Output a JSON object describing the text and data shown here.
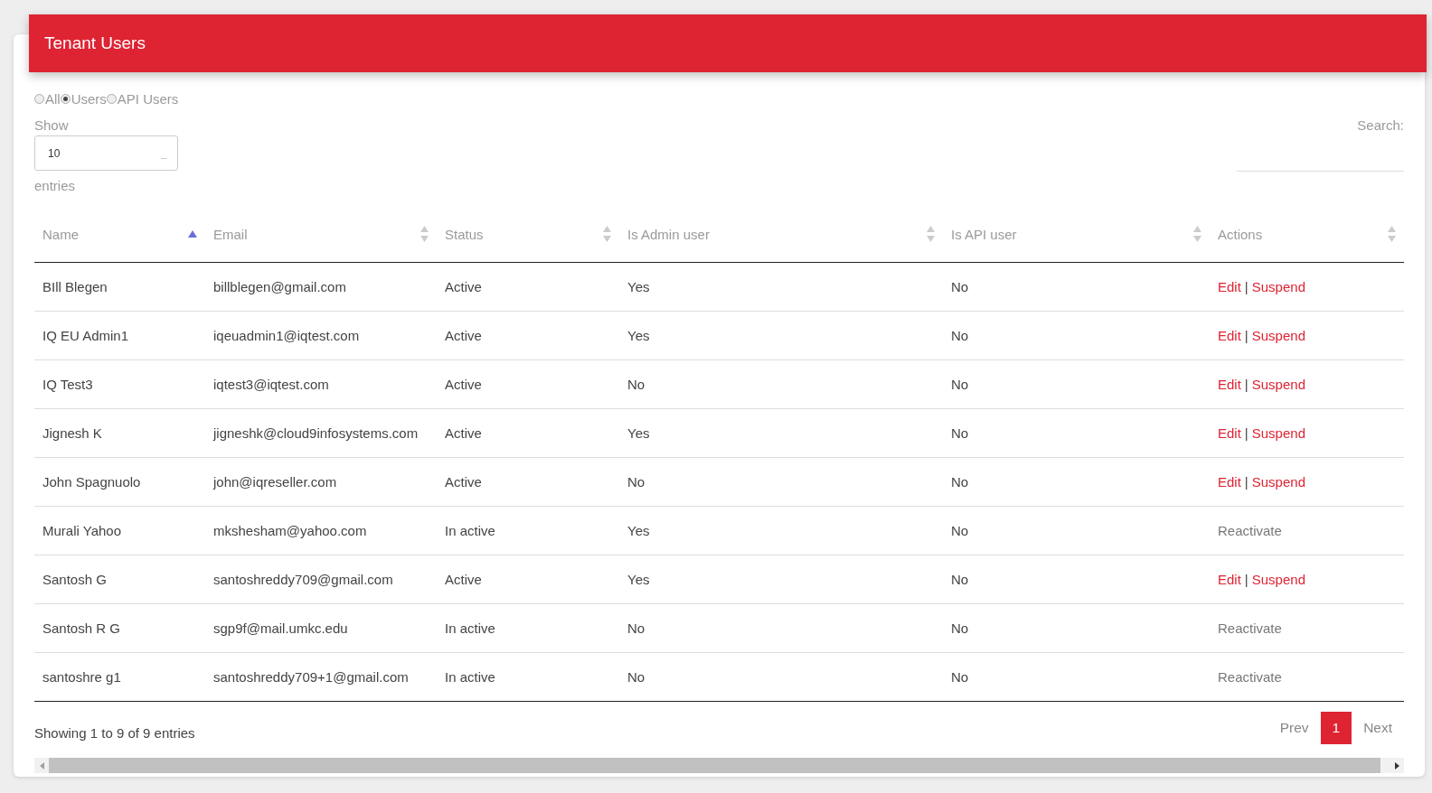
{
  "header": {
    "title": "Tenant Users"
  },
  "filters": [
    {
      "label": "All",
      "selected": false
    },
    {
      "label": "Users",
      "selected": true
    },
    {
      "label": "API Users",
      "selected": false
    }
  ],
  "length_control": {
    "label": "Show",
    "value": "10",
    "caret": "_",
    "suffix": "entries"
  },
  "search": {
    "label": "Search:"
  },
  "table": {
    "columns": [
      {
        "label": "Name",
        "sorted": true
      },
      {
        "label": "Email",
        "sorted": false
      },
      {
        "label": "Status",
        "sorted": false
      },
      {
        "label": "Is Admin user",
        "sorted": false
      },
      {
        "label": "Is API user",
        "sorted": false
      },
      {
        "label": "Actions",
        "sorted": false
      }
    ],
    "rows": [
      {
        "cells": [
          "BIll Blegen",
          "billblegen@gmail.com",
          "Active",
          "Yes",
          "No"
        ],
        "actions": [
          {
            "kind": "link",
            "label": "Edit"
          },
          {
            "kind": "separator",
            "label": "|"
          },
          {
            "kind": "link",
            "label": "Suspend"
          }
        ]
      },
      {
        "cells": [
          "IQ EU Admin1",
          "iqeuadmin1@iqtest.com",
          "Active",
          "Yes",
          "No"
        ],
        "actions": [
          {
            "kind": "link",
            "label": "Edit"
          },
          {
            "kind": "separator",
            "label": "|"
          },
          {
            "kind": "link",
            "label": "Suspend"
          }
        ]
      },
      {
        "cells": [
          "IQ Test3",
          "iqtest3@iqtest.com",
          "Active",
          "No",
          "No"
        ],
        "actions": [
          {
            "kind": "link",
            "label": "Edit"
          },
          {
            "kind": "separator",
            "label": "|"
          },
          {
            "kind": "link",
            "label": "Suspend"
          }
        ]
      },
      {
        "cells": [
          "Jignesh K",
          "jigneshk@cloud9infosystems.com",
          "Active",
          "Yes",
          "No"
        ],
        "actions": [
          {
            "kind": "link",
            "label": "Edit"
          },
          {
            "kind": "separator",
            "label": "|"
          },
          {
            "kind": "link",
            "label": "Suspend"
          }
        ]
      },
      {
        "cells": [
          "John Spagnuolo",
          "john@iqreseller.com",
          "Active",
          "No",
          "No"
        ],
        "actions": [
          {
            "kind": "link",
            "label": "Edit"
          },
          {
            "kind": "separator",
            "label": "|"
          },
          {
            "kind": "link",
            "label": "Suspend"
          }
        ]
      },
      {
        "cells": [
          "Murali Yahoo",
          "mkshesham@yahoo.com",
          "In active",
          "Yes",
          "No"
        ],
        "actions": [
          {
            "kind": "muted",
            "label": "Reactivate"
          }
        ]
      },
      {
        "cells": [
          "Santosh G",
          "santoshreddy709@gmail.com",
          "Active",
          "Yes",
          "No"
        ],
        "actions": [
          {
            "kind": "link",
            "label": "Edit"
          },
          {
            "kind": "separator",
            "label": "|"
          },
          {
            "kind": "link",
            "label": "Suspend"
          }
        ]
      },
      {
        "cells": [
          "Santosh R G",
          "sgp9f@mail.umkc.edu",
          "In active",
          "No",
          "No"
        ],
        "actions": [
          {
            "kind": "muted",
            "label": "Reactivate"
          }
        ]
      },
      {
        "cells": [
          "santoshre g1",
          "santoshreddy709+1@gmail.com",
          "In active",
          "No",
          "No"
        ],
        "actions": [
          {
            "kind": "muted",
            "label": "Reactivate"
          }
        ]
      }
    ]
  },
  "footer": {
    "info": "Showing 1 to 9 of 9 entries"
  },
  "pagination": [
    {
      "label": "Prev",
      "selected": false
    },
    {
      "label": "1",
      "selected": true
    },
    {
      "label": "Next",
      "selected": false
    }
  ]
}
